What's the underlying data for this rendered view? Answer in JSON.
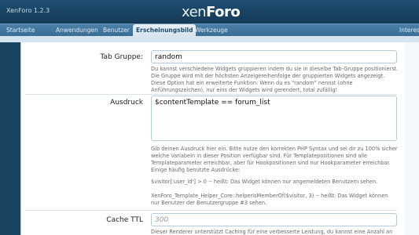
{
  "header": {
    "app_title": "XenForo 1.2.3",
    "logo_part1": "xen",
    "logo_part2": "Foro"
  },
  "nav": {
    "tabs": [
      {
        "label": "Startseite"
      },
      {
        "label": "Anwendungen"
      },
      {
        "label": "Benutzer"
      },
      {
        "label": "Erscheinungsbild",
        "active": true
      },
      {
        "label": "Werkzeuge"
      },
      {
        "label": "Interes"
      }
    ]
  },
  "form": {
    "tab_group": {
      "label": "Tab Gruppe:",
      "value": "random",
      "explain": [
        "Du kannst verschiedene Widgets gruppieren indem du sie in dieselbe Tab-Gruppe positionierst.",
        "Die Gruppe wird mit der höchsten Anzeigereihenfolge der gruppierten Widgets angezeigt.",
        "Diese Option hat ein erweiterte Funktion: Wenn du es \"random\" nennst (ohne",
        "Anführungszeichen), nur eins der Widgets wird gerendert, total zufällig!"
      ]
    },
    "expression": {
      "label": "Ausdruck",
      "value": "$contentTemplate == forum_list",
      "explain": [
        "Gib deinen Ausdruck hier ein. Bitte nutze den korrekten PHP Syntax und sei dir zu 100% sicher",
        "welche Variabeln in dieser Position verfügbar sind. Für Templatepositionen sind alle",
        "Templateparameter erreichbar, aber für Hookpositionen sind nur Hookparameter erreichbar.",
        "Einige häufig benutzte Ausdrücke:"
      ],
      "example1": "$visitor['user_id'] > 0 -- heißt: Das Widget können nur angemeldeten Benutzern sehen.",
      "example2a": "XenForo_Template_Helper_Core::helperIsMemberOf($visitor, 3) -- heißt: Das Widget können",
      "example2b": "nur Benutzer der Benutzergruppe #3 sehen."
    },
    "cache_ttl": {
      "label": "Cache TTL",
      "placeholder": "300",
      "explain": "Dieser Renderer unterstützt Caching für eine verbesserte Leistung, du kannst eine Anzahl an"
    }
  }
}
